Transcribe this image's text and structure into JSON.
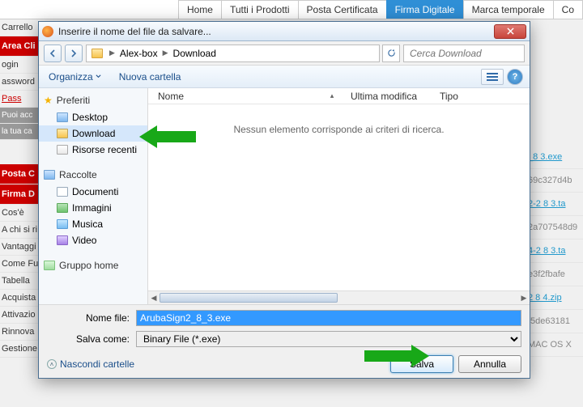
{
  "bg": {
    "nav": {
      "home": "Home",
      "prodotti": "Tutti i Prodotti",
      "posta": "Posta Certificata",
      "firma": "Firma Digitale",
      "marca": "Marca temporale",
      "co": "Co"
    },
    "left": {
      "carrello": "Carrello",
      "area": "Area Cli",
      "login": "ogin",
      "password": "assword",
      "pass_link": "Pass",
      "tip1": "Puoi acc",
      "tip2": "la tua ca",
      "posta": "Posta C",
      "firma": "Firma D",
      "items": [
        "Cos'è",
        "A chi si ri",
        "Vantaggi",
        "Come Fu",
        "Tabella",
        "Acquista",
        "Attivazio",
        "Rinnova",
        "Gestione Firma Remota"
      ]
    },
    "right": {
      "f1": "_8 3.exe",
      "h1": "69c327d4b",
      "f2": "2-2 8 3.ta",
      "h2": "2a707548d9",
      "f3": "4-2 8 3.ta",
      "h3": "e3f2fbafe",
      "f4": "2 8 4.zip",
      "h4": "f5de63181",
      "mac": "MAC OS X"
    }
  },
  "dialog": {
    "title": "Inserire il nome del file da salvare...",
    "crumbs": {
      "root": "Alex-box",
      "leaf": "Download"
    },
    "search_placeholder": "Cerca Download",
    "toolbar": {
      "organize": "Organizza",
      "newfolder": "Nuova cartella"
    },
    "sidebar": {
      "fav_label": "Preferiti",
      "desktop": "Desktop",
      "download": "Download",
      "recent": "Risorse recenti",
      "coll_label": "Raccolte",
      "docs": "Documenti",
      "images": "Immagini",
      "music": "Musica",
      "video": "Video",
      "home": "Gruppo home"
    },
    "columns": {
      "name": "Nome",
      "sort": "▴",
      "mod": "Ultima modifica",
      "type": "Tipo"
    },
    "empty": "Nessun elemento corrisponde ai criteri di ricerca.",
    "filename_label": "Nome file:",
    "filename_value": "ArubaSign2_8_3.exe",
    "saveas_label": "Salva come:",
    "saveas_value": "Binary File (*.exe)",
    "hide_folders": "Nascondi cartelle",
    "save": "Salva",
    "cancel": "Annulla"
  }
}
